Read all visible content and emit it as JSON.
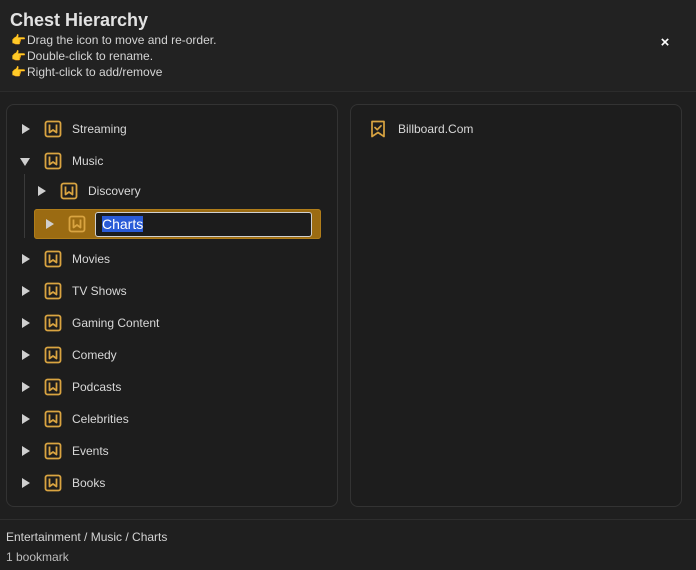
{
  "dialog": {
    "title": "Chest Hierarchy",
    "hints": [
      {
        "icon": "pointing-hand-icon",
        "glyph": "👉",
        "text": "Drag the icon to move and re-order."
      },
      {
        "icon": "pointing-hand-icon",
        "glyph": "👉",
        "text": "Double-click to rename."
      },
      {
        "icon": "pointing-hand-icon",
        "glyph": "👉",
        "text": "Right-click to add/remove"
      }
    ],
    "close_label": "×"
  },
  "colors": {
    "accent": "#9b6b12",
    "icon": "#d9a441",
    "background": "#1f1f1f",
    "selection": "#2a5bd7"
  },
  "tree": {
    "items": [
      {
        "label": "Streaming",
        "expanded": false
      },
      {
        "label": "Music",
        "expanded": true,
        "children": [
          {
            "label": "Discovery",
            "expanded": false
          },
          {
            "label": "Charts",
            "expanded": false,
            "selected": true,
            "editing": true
          }
        ]
      },
      {
        "label": "Movies",
        "expanded": false
      },
      {
        "label": "TV Shows",
        "expanded": false
      },
      {
        "label": "Gaming Content",
        "expanded": false
      },
      {
        "label": "Comedy",
        "expanded": false
      },
      {
        "label": "Podcasts",
        "expanded": false
      },
      {
        "label": "Celebrities",
        "expanded": false
      },
      {
        "label": "Events",
        "expanded": false
      },
      {
        "label": "Books",
        "expanded": false
      }
    ],
    "rename_value": "Charts"
  },
  "bookmarks": [
    {
      "label": "Billboard.Com",
      "icon": "bookmark-icon"
    }
  ],
  "footer": {
    "path": "Entertainment / Music / Charts",
    "count": "1 bookmark"
  }
}
